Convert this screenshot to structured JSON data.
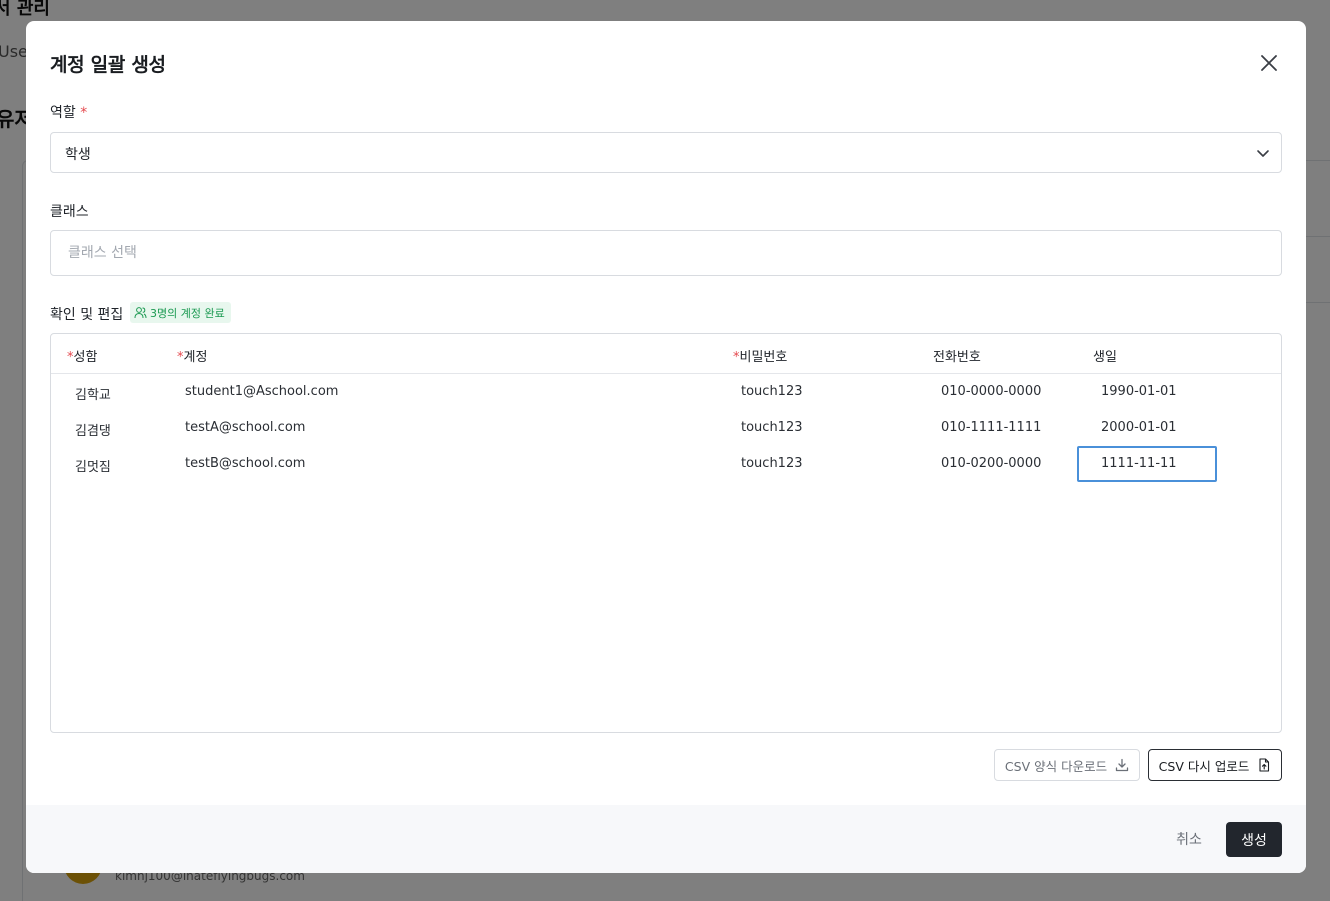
{
  "background": {
    "page_title": "서 관리",
    "tab_label": "Use",
    "heading": "유저",
    "user_email": "kimhj100@inateflyingbugs.com"
  },
  "modal": {
    "title": "계정 일괄 생성",
    "role": {
      "label": "역할",
      "required_mark": "*",
      "value": "학생"
    },
    "class_field": {
      "label": "클래스",
      "placeholder": "클래스 선택"
    },
    "review": {
      "label": "확인 및 편집",
      "badge": "3명의 계정 완료"
    },
    "table": {
      "columns": [
        {
          "label": "성함",
          "required": "*"
        },
        {
          "label": "계정",
          "required": "*"
        },
        {
          "label": "비밀번호",
          "required": "*"
        },
        {
          "label": "전화번호",
          "required": ""
        },
        {
          "label": "생일",
          "required": ""
        }
      ],
      "rows": [
        {
          "name": "김학교",
          "account": "student1@Aschool.com",
          "password": "touch123",
          "phone": "010-0000-0000",
          "birthday": "1990-01-01"
        },
        {
          "name": "김겸댕",
          "account": "testA@school.com",
          "password": "touch123",
          "phone": "010-1111-1111",
          "birthday": "2000-01-01"
        },
        {
          "name": "김멋짐",
          "account": "testB@school.com",
          "password": "touch123",
          "phone": "010-0200-0000",
          "birthday": "1111-11-11"
        }
      ]
    },
    "buttons": {
      "csv_download": "CSV 양식 다운로드",
      "csv_reupload": "CSV 다시 업로드",
      "cancel": "취소",
      "create": "생성"
    },
    "colors": {
      "accent_dark": "#22262d",
      "required": "#e5484d",
      "badge_text": "#1c9a52",
      "badge_bg": "#e8f7ee",
      "active_cell_border": "#4a90d9"
    }
  }
}
